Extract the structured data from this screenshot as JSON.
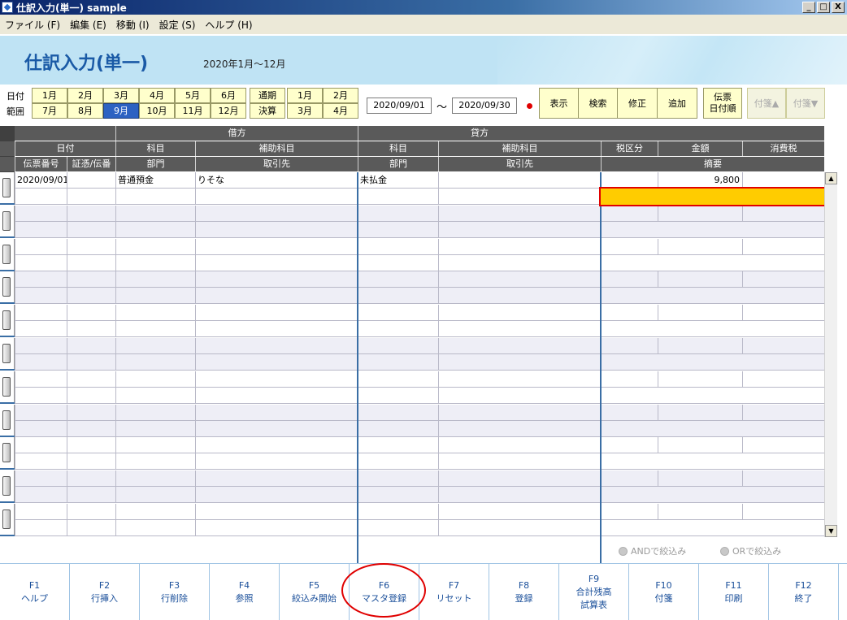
{
  "window": {
    "title": "仕訳入力(単一) sample",
    "btn_min": "_",
    "btn_max": "□",
    "btn_close": "X"
  },
  "menu": [
    "ファイル (F)",
    "編集 (E)",
    "移動 (I)",
    "設定 (S)",
    "ヘルプ (H)"
  ],
  "header": {
    "title": "仕訳入力(単一)",
    "period": "2020年1月～12月"
  },
  "filter": {
    "label_date": "日付",
    "label_range": "範囲",
    "months_row1": [
      "1月",
      "2月",
      "3月",
      "4月",
      "5月",
      "6月"
    ],
    "months_row2": [
      "7月",
      "8月",
      "9月",
      "10月",
      "11月",
      "12月"
    ],
    "selected_month": "9月",
    "special": [
      "通期",
      "決算"
    ],
    "quarters_row1": [
      "1月",
      "2月"
    ],
    "quarters_row2": [
      "3月",
      "4月"
    ],
    "date_from": "2020/09/01",
    "tilde": "～",
    "date_to": "2020/09/30",
    "actions": [
      "表示",
      "検索",
      "修正",
      "追加"
    ],
    "sort_line1": "伝票",
    "sort_line2": "日付順",
    "tag_up": "付箋▲",
    "tag_down": "付箋▼"
  },
  "grid": {
    "group_debit": "借方",
    "group_credit": "貸方",
    "h2": [
      "日付",
      "科目",
      "補助科目",
      "科目",
      "補助科目",
      "税区分",
      "金額",
      "消費税"
    ],
    "h3": [
      "伝票番号",
      "証憑/伝番",
      "部門",
      "取引先",
      "部門",
      "取引先",
      "摘要"
    ],
    "entries": [
      {
        "date": "2020/09/01",
        "debit_account": "普通預金",
        "debit_sub": "りそな",
        "credit_account": "未払金",
        "amount": "9,800"
      }
    ],
    "highlight_color": "#ffcc00"
  },
  "radios": {
    "and_label": "ANDで絞込み",
    "or_label": "ORで絞込み"
  },
  "fkeys": [
    {
      "num": "F1",
      "label": "ヘルプ"
    },
    {
      "num": "F2",
      "label": "行挿入"
    },
    {
      "num": "F3",
      "label": "行削除"
    },
    {
      "num": "F4",
      "label": "参照"
    },
    {
      "num": "F5",
      "label": "絞込み開始"
    },
    {
      "num": "F6",
      "label": "マスタ登録"
    },
    {
      "num": "F7",
      "label": "リセット"
    },
    {
      "num": "F8",
      "label": "登録"
    },
    {
      "num": "F9",
      "label": "合計残高",
      "label2": "試算表"
    },
    {
      "num": "F10",
      "label": "付箋"
    },
    {
      "num": "F11",
      "label": "印刷"
    },
    {
      "num": "F12",
      "label": "終了"
    }
  ]
}
